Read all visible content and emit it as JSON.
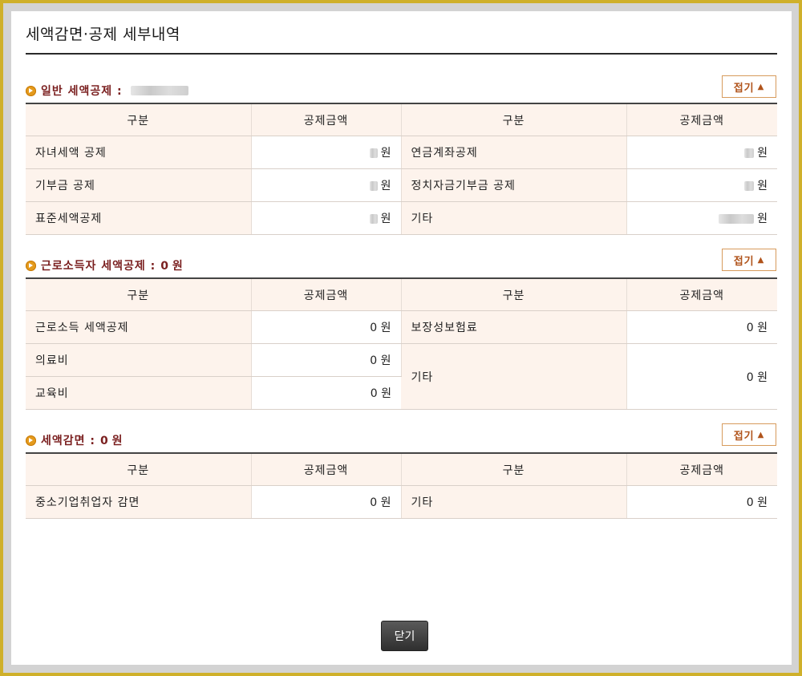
{
  "title": "세액감면·공제 세부내역",
  "close_label": "닫기",
  "fold_label": "접기",
  "fold_icon": "triangle-up-icon",
  "bullet_icon": "circle-arrow-icon",
  "colors": {
    "accent": "#7a1f1f",
    "header_bg": "#fdf3ec",
    "border": "#cfb02a"
  },
  "sections": [
    {
      "title": "일반 세액공제 :",
      "amount": "",
      "headers": [
        "구분",
        "공제금액",
        "구분",
        "공제금액"
      ],
      "rows": [
        {
          "l1": "자녀세액 공제",
          "v1": "원",
          "l2": "연금계좌공제",
          "v2": "원"
        },
        {
          "l1": "기부금 공제",
          "v1": "원",
          "l2": "정치자금기부금 공제",
          "v2": "원"
        },
        {
          "l1": "표준세액공제",
          "v1": "원",
          "l2": "기타",
          "v2": "원"
        }
      ]
    },
    {
      "title": "근로소득자 세액공제 :",
      "amount": "0 원",
      "headers": [
        "구분",
        "공제금액",
        "구분",
        "공제금액"
      ],
      "rows": [
        {
          "l1": "근로소득 세액공제",
          "v1": "0 원",
          "l2": "보장성보험료",
          "v2": "0 원"
        },
        {
          "l1": "의료비",
          "v1": "0 원",
          "l2": "기타",
          "v2": "0 원"
        },
        {
          "l1": "교육비",
          "v1": "0 원"
        }
      ]
    },
    {
      "title": "세액감면 :",
      "amount": "0 원",
      "headers": [
        "구분",
        "공제금액",
        "구분",
        "공제금액"
      ],
      "rows": [
        {
          "l1": "중소기업취업자 감면",
          "v1": "0 원",
          "l2": "기타",
          "v2": "0 원"
        }
      ]
    }
  ]
}
